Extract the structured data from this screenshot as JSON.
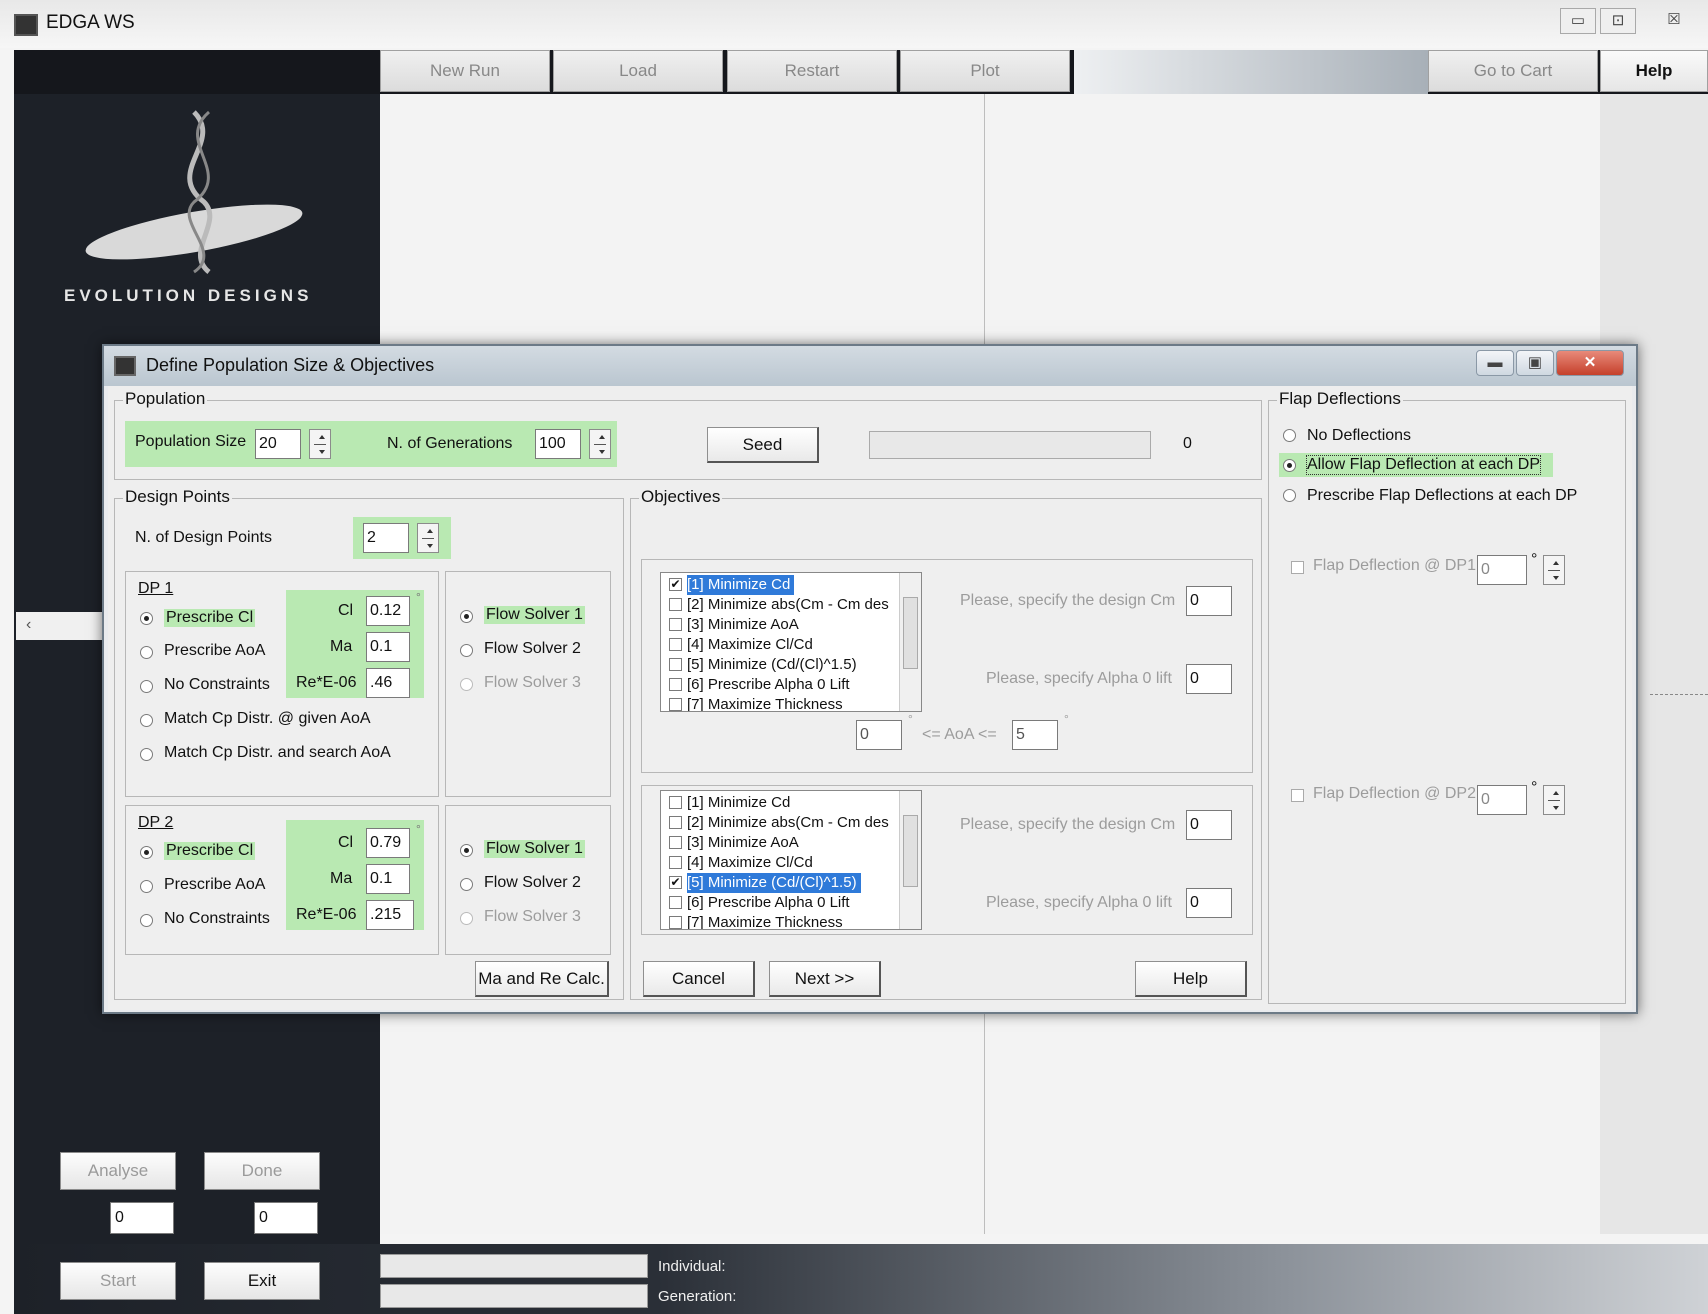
{
  "app": {
    "title": "EDGA WS",
    "logo_text": "EVOLUTION DESIGNS"
  },
  "window_controls": {
    "minimize": "▭",
    "maximize": "⊡",
    "close": "☒"
  },
  "toolbar": {
    "buttons": [
      "New Run",
      "Load",
      "Restart",
      "Plot"
    ],
    "go_to_cart": "Go to Cart",
    "help": "Help"
  },
  "sidebar": {
    "analyse": "Analyse",
    "done": "Done",
    "analyse_value": "0",
    "done_value": "0",
    "start": "Start",
    "exit": "Exit",
    "left_arrow": "‹"
  },
  "status": {
    "individual_label": "Individual:",
    "generation_label": "Generation:"
  },
  "dialog": {
    "title": "Define Population Size & Objectives",
    "controls": {
      "minimize": "▬",
      "maximize": "▣",
      "close": "✕"
    },
    "population": {
      "label": "Population",
      "size_label": "Population Size",
      "size_value": "20",
      "gens_label": "N. of Generations",
      "gens_value": "100",
      "seed": "Seed",
      "seed_value": "0"
    },
    "flap": {
      "label": "Flap Deflections",
      "options": [
        "No Deflections",
        "Allow Flap Deflection at each DP",
        "Prescribe Flap Deflections at each DP"
      ],
      "selected": 1,
      "dp1_label": "Flap Deflection @ DP1",
      "dp1_value": "0",
      "dp2_label": "Flap Deflection @ DP2",
      "dp2_value": "0",
      "deg": "°"
    },
    "design_points": {
      "label": "Design Points",
      "n_label": "N. of Design Points",
      "n_value": "2",
      "dp1": {
        "title": "DP 1",
        "options": [
          "Prescribe Cl",
          "Prescribe AoA",
          "No Constraints",
          "Match Cp Distr. @ given AoA",
          "Match Cp Distr. and search AoA"
        ],
        "cl_label": "Cl",
        "cl_value": "0.12",
        "ma_label": "Ma",
        "ma_value": "0.1",
        "re_label": "Re*E-06",
        "re_value": ".46",
        "solvers": [
          "Flow Solver 1",
          "Flow Solver 2",
          "Flow Solver 3"
        ],
        "cl_deg": "°"
      },
      "dp2": {
        "title": "DP 2",
        "options": [
          "Prescribe Cl",
          "Prescribe AoA",
          "No Constraints"
        ],
        "cl_label": "Cl",
        "cl_value": "0.79",
        "ma_label": "Ma",
        "ma_value": "0.1",
        "re_label": "Re*E-06",
        "re_value": ".215",
        "solvers": [
          "Flow Solver 1",
          "Flow Solver 2",
          "Flow Solver 3"
        ],
        "cl_deg": "°"
      },
      "ma_re_button": "Ma and Re Calc."
    },
    "objectives": {
      "label": "Objectives",
      "items": [
        "[1] Minimize Cd",
        "[2] Minimize abs(Cm - Cm des",
        "[3] Minimize AoA",
        "[4] Maximize Cl/Cd",
        "[5] Minimize (Cd/(Cl)^1.5)",
        "[6] Prescribe Alpha 0 Lift",
        "[7] Maximize Thickness"
      ],
      "dp1_checked": 0,
      "dp2_checked": 4,
      "design_cm_label": "Please, specify the design Cm",
      "design_cm_value": "0",
      "alpha0_label": "Please, specify Alpha 0 lift",
      "alpha0_value": "0",
      "aoa_min": "0",
      "aoa_max": "5",
      "aoa_range_label": "<= AoA <=",
      "deg": "°",
      "dp2_design_cm_value": "0",
      "dp2_alpha0_value": "0"
    },
    "buttons": {
      "cancel": "Cancel",
      "next": "Next >>",
      "help": "Help"
    }
  }
}
